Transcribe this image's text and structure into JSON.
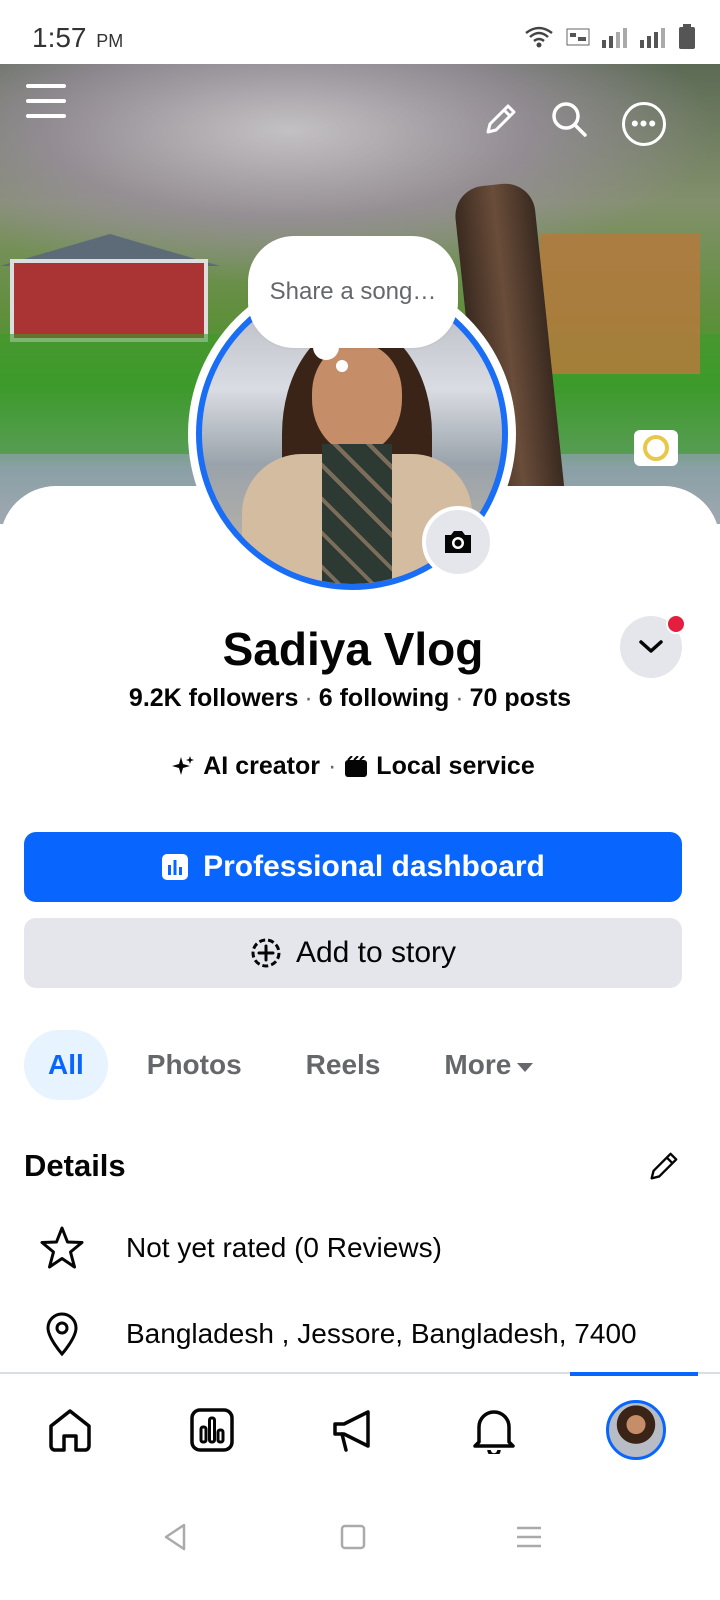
{
  "status_bar": {
    "time": "1:57",
    "ampm": "PM"
  },
  "cover": {
    "bubble_text": "Share a song…"
  },
  "profile": {
    "name": "Sadiya Vlog",
    "followers": "9.2K followers",
    "following": "6 following",
    "posts": "70 posts",
    "category_1": "AI creator",
    "category_2": "Local service"
  },
  "buttons": {
    "dashboard": "Professional dashboard",
    "story": "Add to story"
  },
  "tabs": [
    "All",
    "Photos",
    "Reels",
    "More"
  ],
  "details": {
    "title": "Details",
    "rating": "Not yet rated (0 Reviews)",
    "location": "Bangladesh , Jessore, Bangladesh, 7400"
  },
  "icons": {
    "menu": "menu-icon",
    "edit": "pencil-icon",
    "search": "search-icon",
    "more": "more-icon",
    "camera": "camera-icon",
    "chevron": "chevron-down-icon",
    "star": "star-icon",
    "location": "map-pin-icon",
    "home": "home-icon",
    "dashboard": "dashboard-icon",
    "ads": "megaphone-icon",
    "notifications": "bell-icon",
    "profile": "profile-avatar"
  },
  "colors": {
    "accent": "#0866ff",
    "badge": "#e41e3f",
    "chip_bg": "#e7f3ff",
    "button_gray": "#e4e6eb"
  }
}
